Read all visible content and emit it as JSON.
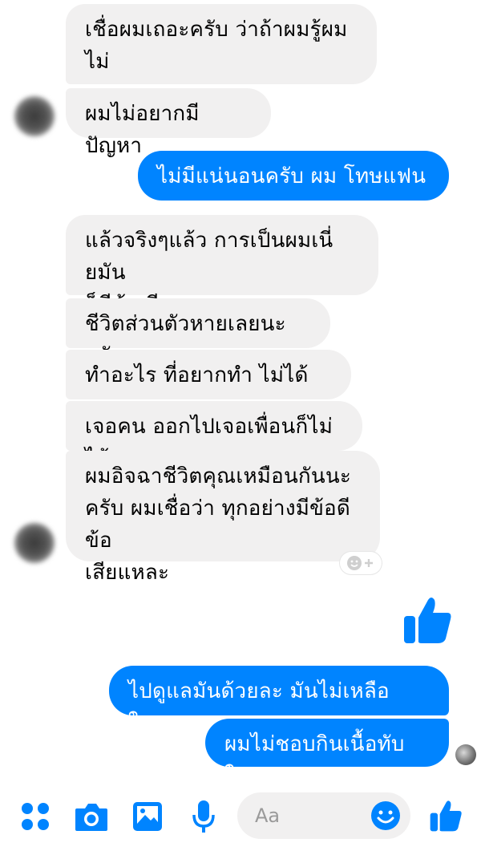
{
  "conversation": {
    "messages": [
      {
        "side": "incoming",
        "text": "เชื่อผมเถอะครับ ว่าถ้าผมรู้ผมไม่\nเอา"
      },
      {
        "side": "incoming",
        "text": "ผมไม่อยากมีปัญหา"
      },
      {
        "side": "outgoing",
        "text": "ไม่มีแน่นอนครับ ผม โทษแฟนผม"
      },
      {
        "side": "incoming",
        "text": "แล้วจริงๆแล้ว การเป็นผมเนี่ยมัน\nก็มีข้อเสียเยอะ"
      },
      {
        "side": "incoming",
        "text": "ชีวิตส่วนตัวหายเลยนะครับ"
      },
      {
        "side": "incoming",
        "text": "ทำอะไร ที่อยากทำ ไม่ได้ เลย"
      },
      {
        "side": "incoming",
        "text": "เจอคน ออกไปเจอเพื่อนก็ไม่ได้"
      },
      {
        "side": "incoming",
        "text": "ผมอิจฉาชีวิตคุณเหมือนกันนะ\nครับ ผมเชื่อว่า ทุกอย่างมีข้อดีข้อ\nเสียแหละ"
      },
      {
        "side": "outgoing",
        "text": "ไปดูแลมันด้วยละ มันไม่เหลือ ใครละ"
      },
      {
        "side": "outgoing",
        "text": "ผมไม่ชอบกินเนื้อทับ ใคร"
      }
    ],
    "like_sticker": "thumbs-up-icon",
    "reaction_button": "add-reaction-icon"
  },
  "composer": {
    "placeholder": "Aa",
    "icons": [
      "apps-icon",
      "camera-icon",
      "image-icon",
      "mic-icon",
      "emoji-icon",
      "thumbs-up-icon"
    ]
  },
  "colors": {
    "accent": "#0084ff",
    "incoming_bubble": "#f1f0f0",
    "outgoing_text": "#ffffff"
  }
}
